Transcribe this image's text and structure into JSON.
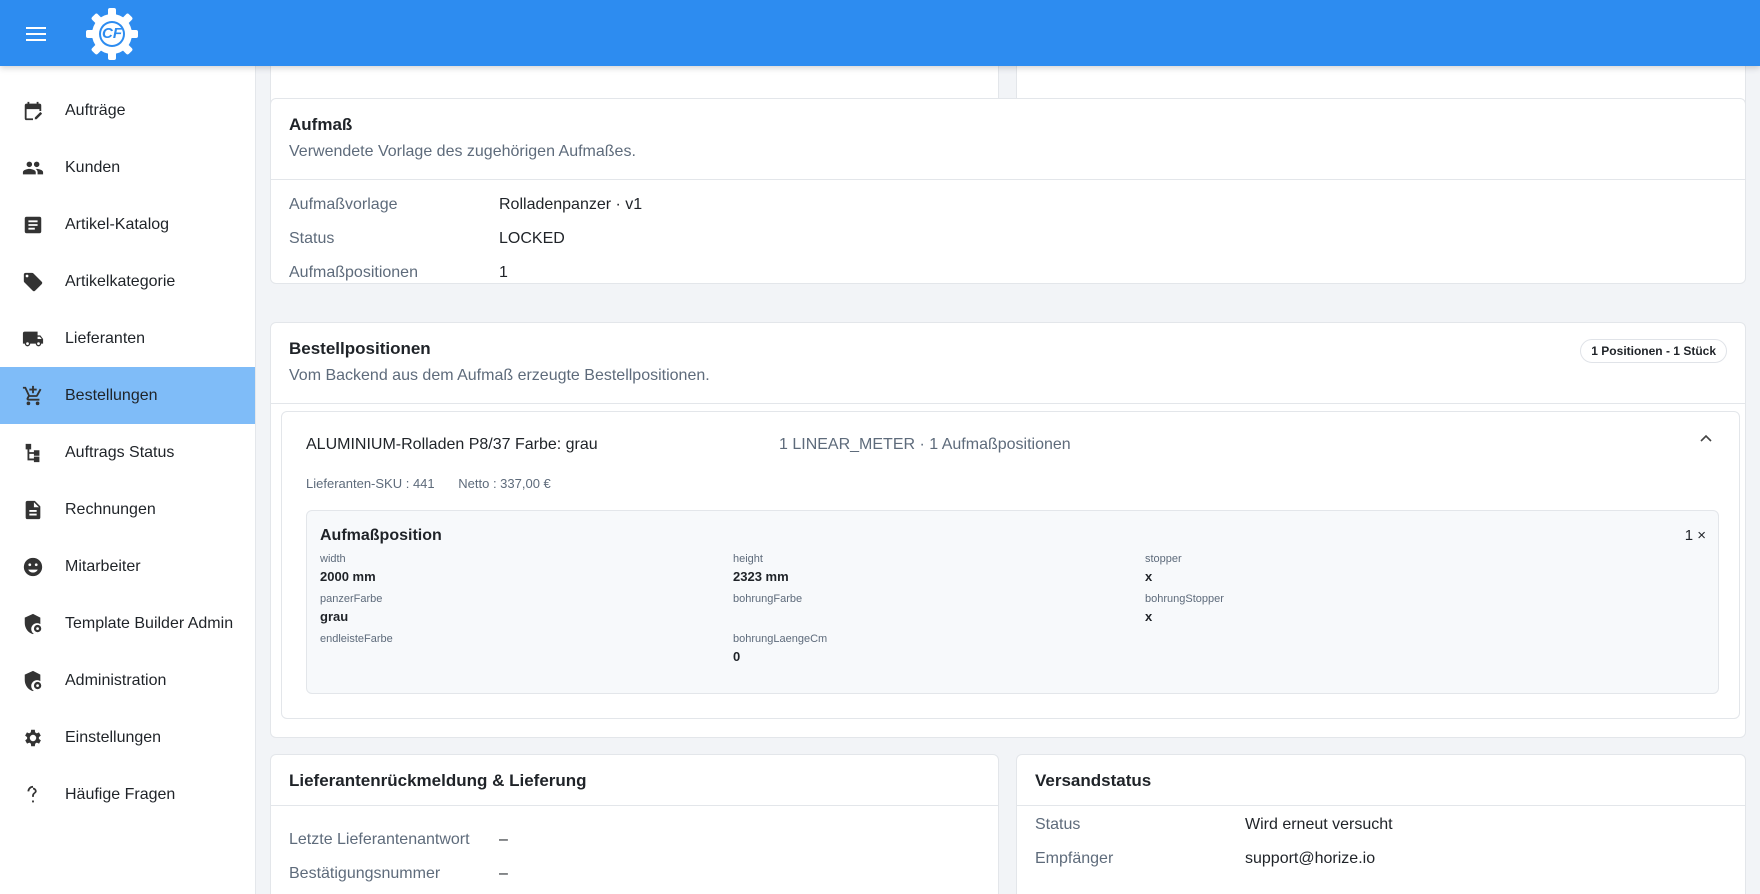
{
  "app": {
    "logo_text": "CF"
  },
  "sidebar": {
    "items": [
      {
        "label": "Aufträge",
        "icon": "calendar-edit-icon"
      },
      {
        "label": "Kunden",
        "icon": "people-icon"
      },
      {
        "label": "Artikel-Katalog",
        "icon": "document-list-icon"
      },
      {
        "label": "Artikelkategorie",
        "icon": "tag-icon"
      },
      {
        "label": "Lieferanten",
        "icon": "truck-icon"
      },
      {
        "label": "Bestellungen",
        "icon": "cart-add-icon",
        "active": true
      },
      {
        "label": "Auftrags Status",
        "icon": "workflow-icon"
      },
      {
        "label": "Rechnungen",
        "icon": "invoice-icon"
      },
      {
        "label": "Mitarbeiter",
        "icon": "staff-icon"
      },
      {
        "label": "Template Builder Admin",
        "icon": "shield-gear-icon"
      },
      {
        "label": "Administration",
        "icon": "shield-gear-icon"
      },
      {
        "label": "Einstellungen",
        "icon": "gear-icon"
      },
      {
        "label": "Häufige Fragen",
        "icon": "question-icon"
      }
    ]
  },
  "aufmass": {
    "title": "Aufmaß",
    "subtitle": "Verwendete Vorlage des zugehörigen Aufmaßes.",
    "rows": [
      {
        "key": "Aufmaßvorlage",
        "value": "Rolladenpanzer · v1"
      },
      {
        "key": "Status",
        "value": "LOCKED"
      },
      {
        "key": "Aufmaßpositionen",
        "value": "1"
      }
    ]
  },
  "bestellpositionen": {
    "title": "Bestellpositionen",
    "subtitle": "Vom Backend aus dem Aufmaß erzeugte Bestellpositionen.",
    "badge": "1 Positionen - 1 Stück",
    "item": {
      "title": "ALUMINIUM-Rolladen P8/37 Farbe: grau",
      "meta": "1 LINEAR_METER · 1 Aufmaßpositionen",
      "sku": "Lieferanten-SKU : 441",
      "netto": "Netto : 337,00 €",
      "position": {
        "title": "Aufmaßposition",
        "qty": "1 ×",
        "fields": [
          {
            "label": "width",
            "value": "2000 mm"
          },
          {
            "label": "height",
            "value": "2323 mm"
          },
          {
            "label": "stopper",
            "value": "x"
          },
          {
            "label": "panzerFarbe",
            "value": "grau"
          },
          {
            "label": "bohrungFarbe",
            "value": ""
          },
          {
            "label": "bohrungStopper",
            "value": "x"
          },
          {
            "label": "endleisteFarbe",
            "value": ""
          },
          {
            "label": "bohrungLaengeCm",
            "value": "0"
          }
        ]
      }
    }
  },
  "lieferung": {
    "title": "Lieferantenrückmeldung & Lieferung",
    "rows": [
      {
        "key": "Letzte Lieferantenantwort",
        "value": "–"
      },
      {
        "key": "Bestätigungsnummer",
        "value": "–"
      }
    ]
  },
  "versand": {
    "title": "Versandstatus",
    "rows": [
      {
        "key": "Status",
        "value": "Wird erneut versucht"
      },
      {
        "key": "Empfänger",
        "value": "support@horize.io"
      }
    ]
  }
}
